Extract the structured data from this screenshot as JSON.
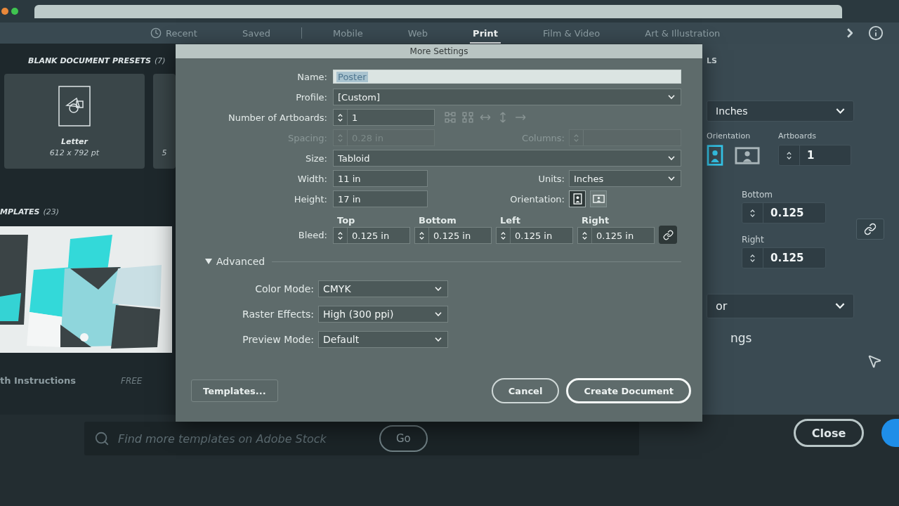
{
  "nav": {
    "history_tabs": [
      {
        "label": "Recent",
        "kind": "icon-label",
        "selected": false
      },
      {
        "label": "Saved",
        "kind": "label",
        "selected": false
      }
    ],
    "category_tabs": [
      {
        "label": "Mobile",
        "selected": false
      },
      {
        "label": "Web",
        "selected": false
      },
      {
        "label": "Print",
        "selected": true
      },
      {
        "label": "Film & Video",
        "selected": false
      },
      {
        "label": "Art & Illustration",
        "selected": false
      }
    ]
  },
  "presets": {
    "title": "BLANK DOCUMENT PRESETS",
    "count": "(7)",
    "items": [
      {
        "kind": "document",
        "name": "Letter",
        "size": "612 x 792 pt"
      },
      {
        "kind": "cut",
        "size": "5"
      }
    ]
  },
  "templates": {
    "title": "MPLATES",
    "count": "(23)",
    "items": [
      {
        "name": "th Instructions",
        "price": "FREE"
      }
    ]
  },
  "right_panel": {
    "heading": "LS",
    "units": "Inches",
    "orientation_label": "Orientation",
    "orientation": [
      {
        "kind": "portrait",
        "selected": true
      },
      {
        "kind": "landscape",
        "selected": false
      }
    ],
    "artboards_label": "Artboards",
    "artboards": "1",
    "bleed": [
      {
        "label": "Bottom",
        "value": "0.125"
      },
      {
        "label": "Right",
        "value": "0.125"
      }
    ],
    "select_value": "or",
    "text": "ngs"
  },
  "bottom_bar": {
    "search": {
      "placeholder": "Find more templates on Adobe Stock"
    },
    "go_button": "Go",
    "close_button": "Close"
  },
  "dialog": {
    "title": "More Settings",
    "name": {
      "label": "Name:",
      "value": "Poster",
      "text_selected": true
    },
    "profile": {
      "label": "Profile:",
      "value": "[Custom]"
    },
    "artboards": {
      "label": "Number of Artboards:",
      "value": "1",
      "arrange_buttons": [
        {
          "kind": "grid-by-row",
          "disabled": true
        },
        {
          "kind": "grid-by-column",
          "disabled": true
        },
        {
          "kind": "row",
          "disabled": true
        },
        {
          "kind": "column",
          "disabled": true
        },
        {
          "kind": "right-to-left",
          "disabled": true
        }
      ]
    },
    "spacing": {
      "label": "Spacing:",
      "value": "0.28 in",
      "disabled": true
    },
    "columns": {
      "label": "Columns:",
      "disabled": true
    },
    "size": {
      "label": "Size:",
      "value": "Tabloid"
    },
    "width": {
      "label": "Width:",
      "value": "11 in"
    },
    "units": {
      "label": "Units:",
      "value": "Inches"
    },
    "height": {
      "label": "Height:",
      "value": "17 in"
    },
    "orientation": {
      "label": "Orientation:",
      "options": [
        {
          "kind": "portrait",
          "selected": true
        },
        {
          "kind": "landscape",
          "selected": false
        }
      ]
    },
    "bleed": {
      "label": "Bleed:",
      "fields": [
        {
          "label": "Top",
          "value": "0.125 in"
        },
        {
          "label": "Bottom",
          "value": "0.125 in"
        },
        {
          "label": "Left",
          "value": "0.125 in"
        },
        {
          "label": "Right",
          "value": "0.125 in"
        }
      ],
      "linked": true
    },
    "advanced": {
      "label": "Advanced",
      "expanded": true,
      "fields": [
        {
          "label": "Color Mode:",
          "value": "CMYK"
        },
        {
          "label": "Raster Effects:",
          "value": "High (300 ppi)"
        },
        {
          "label": "Preview Mode:",
          "value": "Default"
        }
      ]
    },
    "buttons": {
      "templates": "Templates...",
      "cancel": "Cancel",
      "create": "Create Document"
    }
  }
}
